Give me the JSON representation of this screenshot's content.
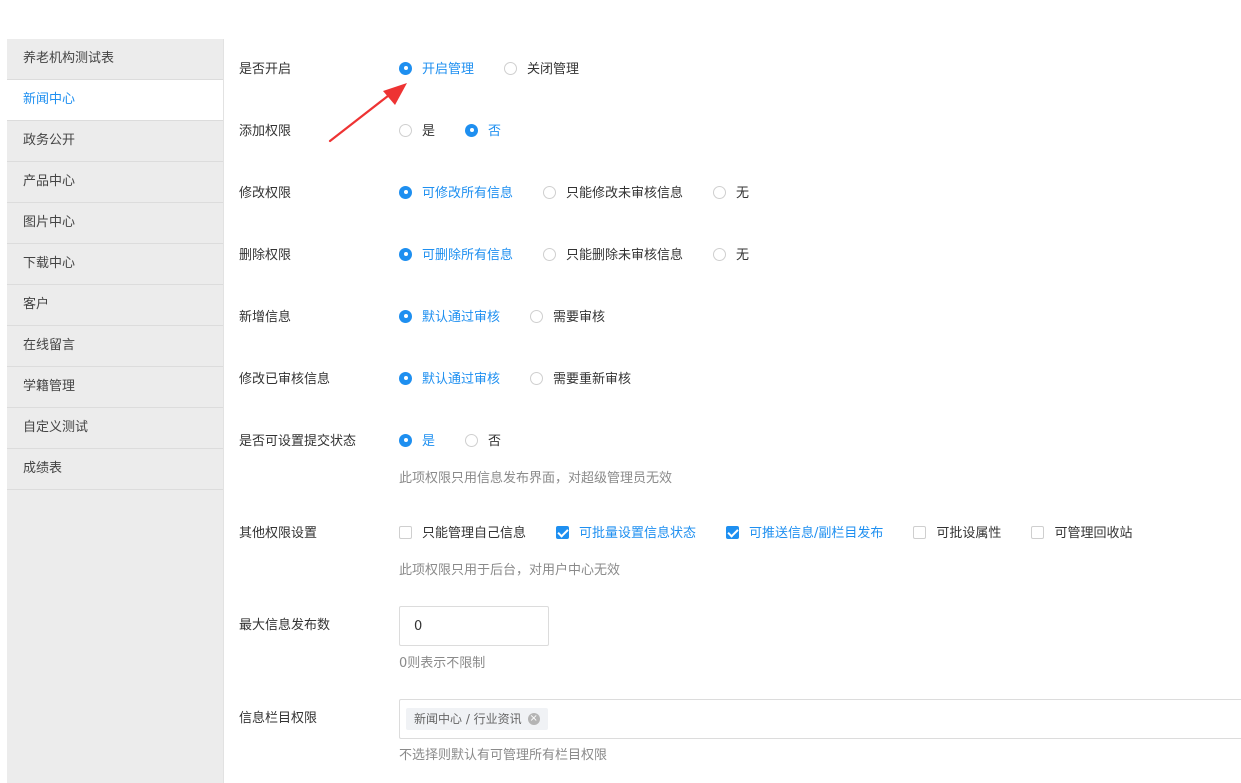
{
  "sidebar": {
    "items": [
      {
        "label": "养老机构测试表",
        "active": false
      },
      {
        "label": "新闻中心",
        "active": true
      },
      {
        "label": "政务公开",
        "active": false
      },
      {
        "label": "产品中心",
        "active": false
      },
      {
        "label": "图片中心",
        "active": false
      },
      {
        "label": "下载中心",
        "active": false
      },
      {
        "label": "客户",
        "active": false
      },
      {
        "label": "在线留言",
        "active": false
      },
      {
        "label": "学籍管理",
        "active": false
      },
      {
        "label": "自定义测试",
        "active": false
      },
      {
        "label": "成绩表",
        "active": false
      }
    ]
  },
  "form": {
    "enable": {
      "label": "是否开启",
      "options": [
        "开启管理",
        "关闭管理"
      ],
      "selected": 0
    },
    "add": {
      "label": "添加权限",
      "options": [
        "是",
        "否"
      ],
      "selected": 1
    },
    "edit": {
      "label": "修改权限",
      "options": [
        "可修改所有信息",
        "只能修改未审核信息",
        "无"
      ],
      "selected": 0
    },
    "delete": {
      "label": "删除权限",
      "options": [
        "可删除所有信息",
        "只能删除未审核信息",
        "无"
      ],
      "selected": 0
    },
    "new_info": {
      "label": "新增信息",
      "options": [
        "默认通过审核",
        "需要审核"
      ],
      "selected": 0
    },
    "edit_reviewed": {
      "label": "修改已审核信息",
      "options": [
        "默认通过审核",
        "需要重新审核"
      ],
      "selected": 0
    },
    "submit_status": {
      "label": "是否可设置提交状态",
      "options": [
        "是",
        "否"
      ],
      "selected": 0,
      "hint": "此项权限只用信息发布界面，对超级管理员无效"
    },
    "other": {
      "label": "其他权限设置",
      "options": [
        "只能管理自己信息",
        "可批量设置信息状态",
        "可推送信息/副栏目发布",
        "可批设属性",
        "可管理回收站"
      ],
      "checked": [
        false,
        true,
        true,
        false,
        false
      ],
      "hint": "此项权限只用于后台，对用户中心无效"
    },
    "max_publish": {
      "label": "最大信息发布数",
      "value": "0",
      "hint": "0则表示不限制"
    },
    "columns": {
      "label": "信息栏目权限",
      "tags": [
        "新闻中心 / 行业资讯"
      ],
      "hint": "不选择则默认有可管理所有栏目权限"
    }
  },
  "colors": {
    "accent": "#1e8ff0",
    "annotation_arrow": "#ee3333",
    "sidebar_bg": "#ececec"
  },
  "icons": {
    "tag_remove": "close-circle-icon",
    "annotation": "red-arrow-annotation"
  }
}
